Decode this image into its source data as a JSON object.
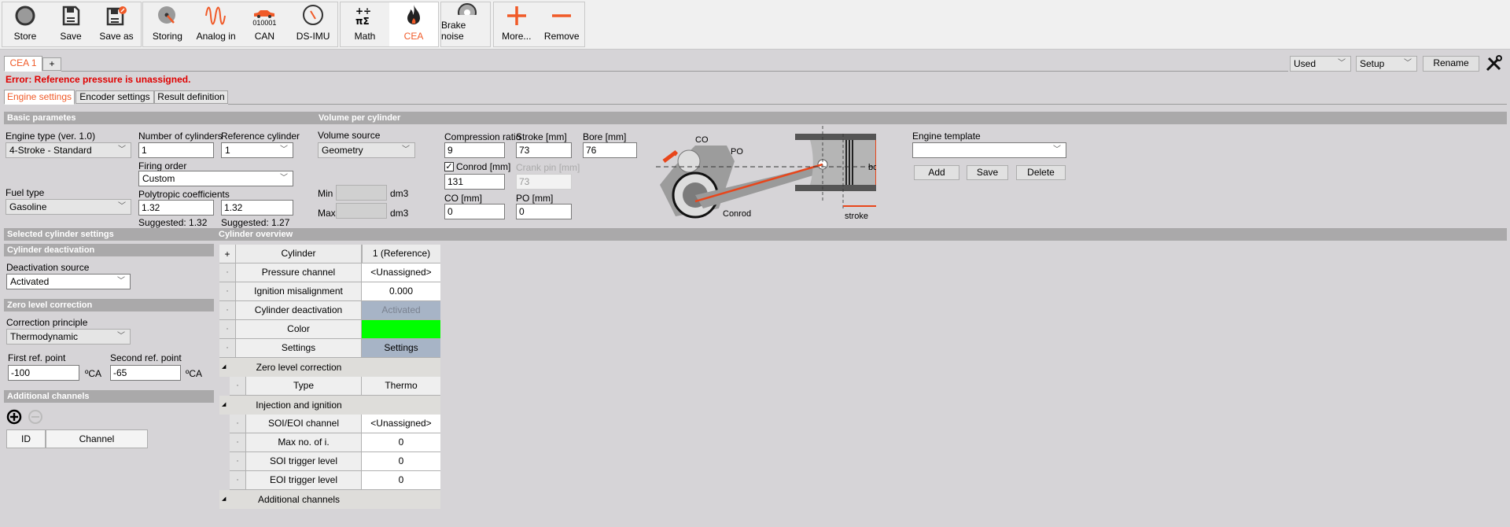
{
  "toolbar": {
    "groups": [
      [
        {
          "label": "Store",
          "icon": "record-icon"
        },
        {
          "label": "Save",
          "icon": "floppy-icon"
        },
        {
          "label": "Save as",
          "icon": "floppy-edit-icon"
        }
      ],
      [
        {
          "label": "Storing",
          "icon": "disk-icon"
        },
        {
          "label": "Analog in",
          "icon": "sine-wave-icon"
        },
        {
          "label": "CAN",
          "icon": "car-icon",
          "sub": "010001"
        },
        {
          "label": "DS-IMU",
          "icon": "compass-icon"
        }
      ],
      [
        {
          "label": "Math",
          "icon": "math-icon"
        },
        {
          "label": "CEA",
          "icon": "flame-icon"
        }
      ],
      [
        {
          "label": "Brake noise",
          "icon": "brake-icon"
        }
      ],
      [
        {
          "label": "More...",
          "icon": "plus-icon"
        },
        {
          "label": "Remove",
          "icon": "minus-icon"
        }
      ]
    ]
  },
  "tabs": {
    "items": [
      "CEA 1"
    ],
    "add": "+"
  },
  "top_right": {
    "used": "Used",
    "setup": "Setup",
    "rename": "Rename"
  },
  "error": "Error: Reference pressure is unassigned.",
  "subtabs": [
    "Engine settings",
    "Encoder settings",
    "Result definition"
  ],
  "basic": {
    "title": "Basic parametes",
    "engine_type_label": "Engine type (ver. 1.0)",
    "engine_type": "4-Stroke - Standard",
    "num_cyl_label": "Number of cylinders",
    "num_cyl": "1",
    "ref_cyl_label": "Reference cylinder",
    "ref_cyl": "1",
    "firing_label": "Firing order",
    "firing": "Custom",
    "fuel_label": "Fuel type",
    "fuel": "Gasoline",
    "poly_label": "Polytropic coefficients",
    "poly1": "1.32",
    "poly2": "1.32",
    "sugg1": "Suggested: 1.32",
    "sugg2": "Suggested: 1.27"
  },
  "volume": {
    "title": "Volume per cylinder",
    "source_label": "Volume source",
    "source": "Geometry",
    "min_label": "Min",
    "max_label": "Max",
    "unit": "dm3",
    "comp_label": "Compression ratio",
    "comp": "9",
    "stroke_label": "Stroke [mm]",
    "stroke": "73",
    "bore_label": "Bore [mm]",
    "bore": "76",
    "conrod_label": "Conrod [mm]",
    "conrod": "131",
    "conrod_checked": true,
    "crank_label": "Crank pin [mm]",
    "crank": "73",
    "co_label": "CO [mm]",
    "co": "0",
    "po_label": "PO [mm]",
    "po": "0"
  },
  "diagram": {
    "co": "CO",
    "po": "PO",
    "conrod": "Conrod",
    "bore": "bore",
    "stroke": "stroke",
    "plus": "+",
    "minus": "−"
  },
  "template": {
    "label": "Engine template",
    "value": "",
    "add": "Add",
    "save": "Save",
    "delete": "Delete"
  },
  "selected": {
    "title": "Selected cylinder settings",
    "deact_title": "Cylinder deactivation",
    "deact_label": "Deactivation source",
    "deact": "Activated",
    "zero_title": "Zero level correction",
    "principle_label": "Correction principle",
    "principle": "Thermodynamic",
    "first_label": "First ref. point",
    "first": "-100",
    "second_label": "Second ref. point",
    "second": "-65",
    "unit": "ºCA",
    "add_title": "Additional channels",
    "cols": [
      "ID",
      "Channel"
    ]
  },
  "overview": {
    "title": "Cylinder overview",
    "add": "+",
    "header": [
      "Cylinder",
      "1 (Reference)"
    ],
    "rows": [
      {
        "k": "Pressure channel",
        "v": "<Unassigned>"
      },
      {
        "k": "Ignition misalignment",
        "v": "0.000"
      },
      {
        "k": "Cylinder deactivation",
        "v": "Activated"
      },
      {
        "k": "Color",
        "v": ""
      },
      {
        "k": "Settings",
        "v": "Settings"
      }
    ],
    "zero_group": "Zero level correction",
    "zero_rows": [
      {
        "k": "Type",
        "v": "Thermo"
      }
    ],
    "inj_group": "Injection and ignition",
    "inj_rows": [
      {
        "k": "SOI/EOI channel",
        "v": "<Unassigned>"
      },
      {
        "k": "Max no. of i.",
        "v": "0"
      },
      {
        "k": "SOI trigger level",
        "v": "0"
      },
      {
        "k": "EOI trigger level",
        "v": "0"
      }
    ],
    "add_group": "Additional channels"
  },
  "colors": {
    "accent": "#f05a28",
    "error": "#e00000",
    "cyl_color": "#00ff00",
    "cell_blue": "#a7b4c6"
  }
}
